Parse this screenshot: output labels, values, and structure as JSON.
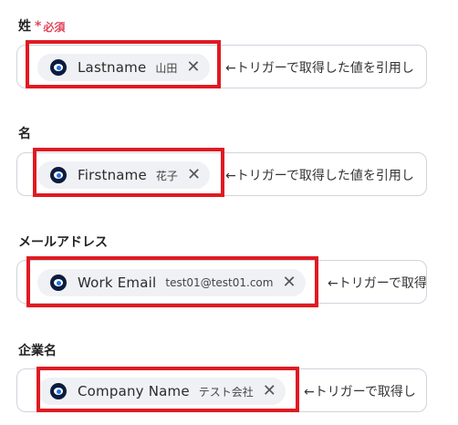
{
  "fields": [
    {
      "label": "姓",
      "required": "必須",
      "required_mark": "*",
      "chip_name": "Lastname",
      "chip_value": "山田",
      "hint": "←トリガーで取得した値を引用し"
    },
    {
      "label": "名",
      "chip_name": "Firstname",
      "chip_value": "花子",
      "hint": "←トリガーで取得した値を引用し"
    },
    {
      "label": "メールアドレス",
      "chip_name": "Work Email",
      "chip_value": "test01@test01.com",
      "hint": "←トリガーで取得"
    },
    {
      "label": "企業名",
      "chip_name": "Company Name",
      "chip_value": "テスト会社",
      "hint": "←トリガーで取得し"
    }
  ],
  "remove_glyph": "✕",
  "colors": {
    "highlight_border": "#e01a22",
    "required": "#e0455a",
    "chip_bg": "#f0f1f5",
    "field_border": "#cfd4dc"
  }
}
